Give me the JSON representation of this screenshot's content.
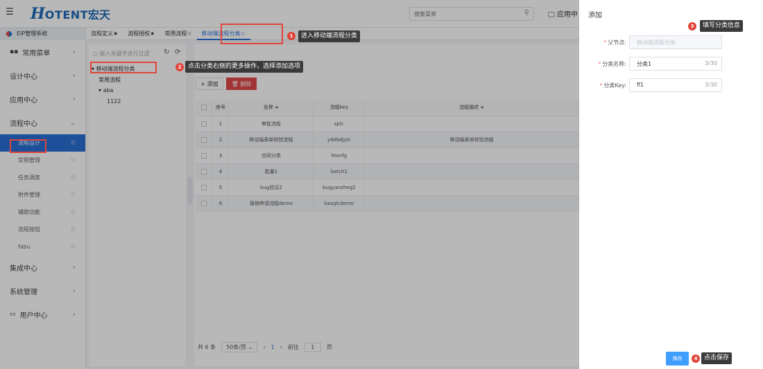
{
  "topbar": {
    "logo_h": "H",
    "logo_rest": "OTENT",
    "logo_cn": "宏天",
    "search_placeholder": "搜索菜单",
    "app_center": "应用中"
  },
  "sidebar": {
    "system_title": "EIP管理系统",
    "groups": [
      {
        "label": "常用菜单"
      },
      {
        "label": "设计中心"
      },
      {
        "label": "应用中心"
      },
      {
        "label": "流程中心"
      }
    ],
    "process_items": [
      {
        "label": "流程设计"
      },
      {
        "label": "实例管理"
      },
      {
        "label": "任务调度"
      },
      {
        "label": "附件管理"
      },
      {
        "label": "辅助功能"
      },
      {
        "label": "流程按钮"
      },
      {
        "label": "fabu"
      }
    ],
    "bottom_groups": [
      {
        "label": "集成中心"
      },
      {
        "label": "系统管理"
      },
      {
        "label": "用户中心"
      }
    ]
  },
  "tabs": [
    {
      "label": "流程定义★"
    },
    {
      "label": "流程授权★"
    },
    {
      "label": "常用流程☆"
    },
    {
      "label": "移动端流程分类☆"
    }
  ],
  "tree": {
    "search_placeholder": "输入关键字进行过滤",
    "nodes": [
      {
        "label": "移动端流程分类"
      },
      {
        "label": "常用流程"
      },
      {
        "label": "aba"
      },
      {
        "label": "1122"
      }
    ]
  },
  "toolbar": {
    "add_label": "+ 添加",
    "delete_label": "删除"
  },
  "table": {
    "headers": {
      "index": "序号",
      "name": "名称 ≑",
      "key": "流程key",
      "desc": "流程描述 ≑"
    },
    "rows": [
      {
        "index": "1",
        "name": "审批流程",
        "key": "splc",
        "desc": ""
      },
      {
        "index": "2",
        "name": "移动端表单校验流程",
        "key": "yddbdjylc",
        "desc": "移动端表单校验流程"
      },
      {
        "index": "3",
        "name": "合同分类",
        "key": "htonfg",
        "desc": ""
      },
      {
        "index": "4",
        "name": "批量1",
        "key": "batch1",
        "desc": ""
      },
      {
        "index": "5",
        "name": "bug验证2",
        "key": "bugyanzheg2",
        "desc": ""
      },
      {
        "index": "6",
        "name": "报销申请流程demo",
        "key": "bxsqlcdemo",
        "desc": ""
      }
    ]
  },
  "pager": {
    "total": "共 6 条",
    "page_size": "50条/页",
    "current": "1",
    "goto_label": "前往",
    "goto_value": "1",
    "page_unit": "页"
  },
  "drawer": {
    "title": "添加",
    "fields": [
      {
        "label": "父节点:",
        "value": "移动端流程分类",
        "counter": ""
      },
      {
        "label": "分类名称:",
        "value": "分类1",
        "counter": "3/30"
      },
      {
        "label": "分类Key:",
        "value": "fl1",
        "counter": "3/30"
      }
    ],
    "save_label": "保存"
  },
  "annotations": [
    {
      "num": "1",
      "text": "进入移动端流程分类"
    },
    {
      "num": "2",
      "text": "点击分类右侧的更多操作，选择添加选项"
    },
    {
      "num": "3",
      "text": "填写分类信息"
    },
    {
      "num": "4",
      "text": "点击保存"
    }
  ],
  "colors": {
    "accent": "#2a6fd6",
    "danger": "#e04a4a",
    "annotation": "#e0443a",
    "save": "#409eff"
  }
}
